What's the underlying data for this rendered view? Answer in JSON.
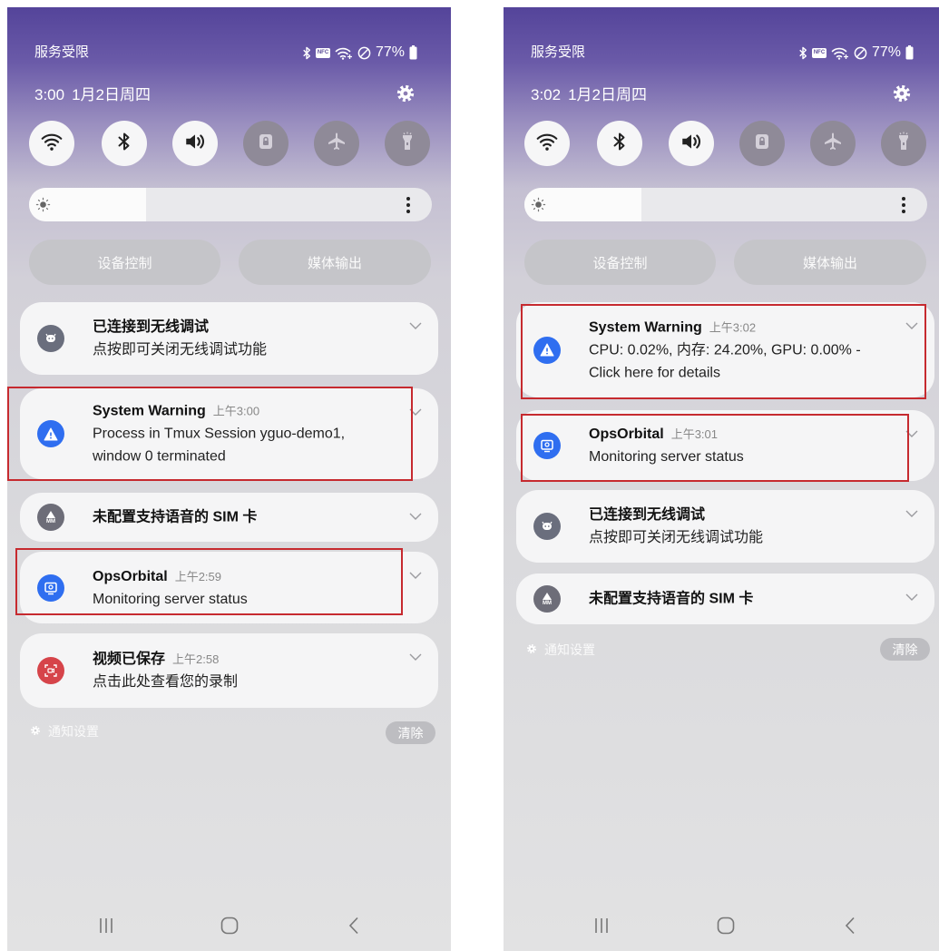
{
  "phones": [
    {
      "status": {
        "carrier": "服务受限",
        "nfc": "NFC",
        "battery": "77%"
      },
      "header": {
        "time": "3:00",
        "date": "1月2日周四"
      },
      "quick_toggles": [
        {
          "icon": "wifi-icon",
          "active": true
        },
        {
          "icon": "bluetooth-icon",
          "active": true
        },
        {
          "icon": "sound-icon",
          "active": true
        },
        {
          "icon": "screen-lock-icon",
          "active": false
        },
        {
          "icon": "airplane-icon",
          "active": false
        },
        {
          "icon": "flashlight-icon",
          "active": false
        }
      ],
      "brightness": {
        "level": 0.29
      },
      "buttons": {
        "device_control": "设备控制",
        "media_output": "媒体输出"
      },
      "notifications": [
        {
          "title": "已连接到无线调试",
          "lines": [
            "点按即可关闭无线调试功能"
          ],
          "icon": "wireless-debugging-icon",
          "highlighted": false
        },
        {
          "title": "System Warning",
          "time": "上午3:00",
          "lines": [
            "Process in Tmux Session yguo-demo1,",
            "window 0 terminated"
          ],
          "icon": "warning-icon",
          "highlighted": true
        },
        {
          "title": "未配置支持语音的 SIM 卡",
          "lines": [],
          "icon": "sim-icon",
          "icon_text": "MM",
          "highlighted": false
        },
        {
          "title": "OpsOrbital",
          "time": "上午2:59",
          "lines": [
            "Monitoring server status"
          ],
          "icon": "monitor-icon",
          "highlighted": true
        },
        {
          "title": "视频已保存",
          "time": "上午2:58",
          "lines": [
            "点击此处查看您的录制"
          ],
          "icon": "screen-record-icon",
          "highlighted": false
        }
      ],
      "footer": {
        "settings": "通知设置",
        "clear": "清除"
      }
    },
    {
      "status": {
        "carrier": "服务受限",
        "nfc": "NFC",
        "battery": "77%"
      },
      "header": {
        "time": "3:02",
        "date": "1月2日周四"
      },
      "quick_toggles": [
        {
          "icon": "wifi-icon",
          "active": true
        },
        {
          "icon": "bluetooth-icon",
          "active": true
        },
        {
          "icon": "sound-icon",
          "active": true
        },
        {
          "icon": "screen-lock-icon",
          "active": false
        },
        {
          "icon": "airplane-icon",
          "active": false
        },
        {
          "icon": "flashlight-icon",
          "active": false
        }
      ],
      "brightness": {
        "level": 0.29
      },
      "buttons": {
        "device_control": "设备控制",
        "media_output": "媒体输出"
      },
      "notifications": [
        {
          "title": "System Warning",
          "time": "上午3:02",
          "lines": [
            "CPU: 0.02%, 内存: 24.20%, GPU: 0.00% -",
            "Click here for details"
          ],
          "icon": "warning-icon",
          "highlighted": true
        },
        {
          "title": "OpsOrbital",
          "time": "上午3:01",
          "lines": [
            "Monitoring server status"
          ],
          "icon": "monitor-icon",
          "highlighted": true
        },
        {
          "title": "已连接到无线调试",
          "lines": [
            "点按即可关闭无线调试功能"
          ],
          "icon": "wireless-debugging-icon",
          "highlighted": false
        },
        {
          "title": "未配置支持语音的 SIM 卡",
          "lines": [],
          "icon": "sim-icon",
          "icon_text": "MM",
          "highlighted": false
        }
      ],
      "footer": {
        "settings": "通知设置",
        "clear": "清除"
      }
    }
  ],
  "colors": {
    "highlight_border": "#c62a2f",
    "accent_blue": "#2f6ef0",
    "alert_red": "#d6444a"
  }
}
